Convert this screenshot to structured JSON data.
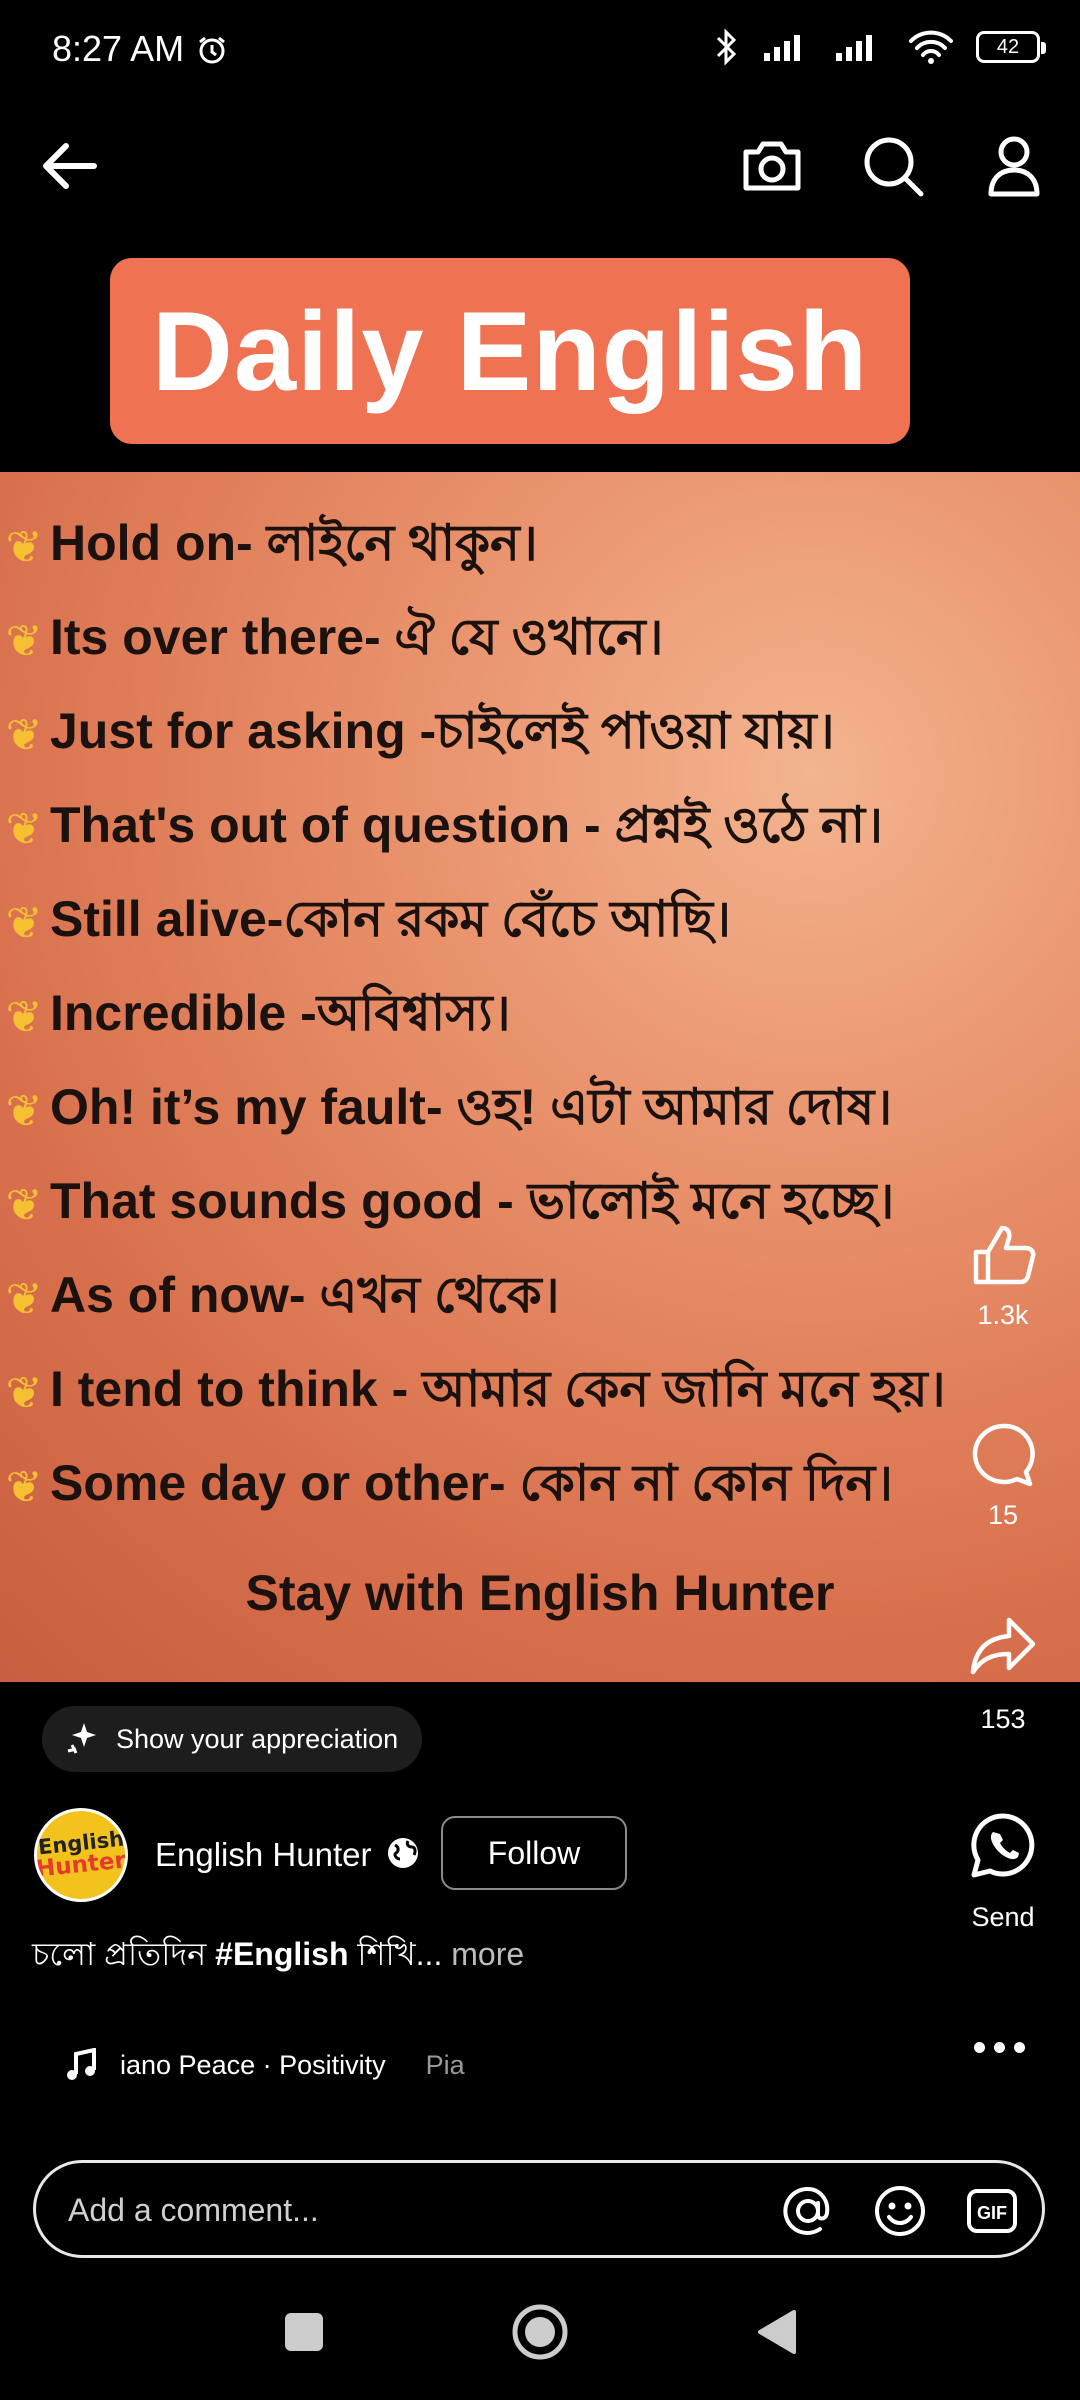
{
  "status_bar": {
    "time": "8:27 AM",
    "battery": "42"
  },
  "post": {
    "banner_title": "Daily English",
    "phrases": [
      "Hold on-  লাইনে থাকুন।",
      "Its over there- ঐ যে ওখানে।",
      "Just for asking -চাইলেই পাওয়া যায়।",
      "That's out of question - প্রশ্নই ওঠে না।",
      "Still alive-কোন রকম বেঁচে আছি।",
      "Incredible -অবিশ্বাস্য।",
      "Oh! it’s my fault- ওহ! এটা আমার দোষ।",
      "That sounds good - ভালোই মনে হচ্ছে।",
      "As of now- এখন থেকে।",
      "I tend to think - আমার কেন জানি মনে হয়।",
      "Some day or other- কোন না কোন দিন।"
    ],
    "footer": "Stay with English Hunter"
  },
  "actions": {
    "like_count": "1.3k",
    "comment_count": "15",
    "share_count": "153",
    "send_label": "Send"
  },
  "appreciation": {
    "label": "Show your appreciation"
  },
  "author": {
    "avatar_line1": "English",
    "avatar_line2": "Hunter",
    "name": "English Hunter",
    "follow_label": "Follow"
  },
  "caption": {
    "prefix": "চলো প্রতিদিন ",
    "hashtag": "#English",
    "suffix": " শিখি...",
    "more": "more"
  },
  "music": {
    "track": "iano Peace · Positivity",
    "next": "Pia"
  },
  "comment": {
    "placeholder": "Add a comment..."
  },
  "colors": {
    "banner": "#ef7352",
    "background": "#000000",
    "accent_wheat": "#f5c133"
  },
  "icons": [
    "back-arrow-icon",
    "camera-icon",
    "search-icon",
    "profile-icon",
    "like-icon",
    "comment-icon",
    "share-icon",
    "whatsapp-icon",
    "more-icon",
    "music-note-icon",
    "mention-icon",
    "emoji-icon",
    "gif-icon"
  ]
}
